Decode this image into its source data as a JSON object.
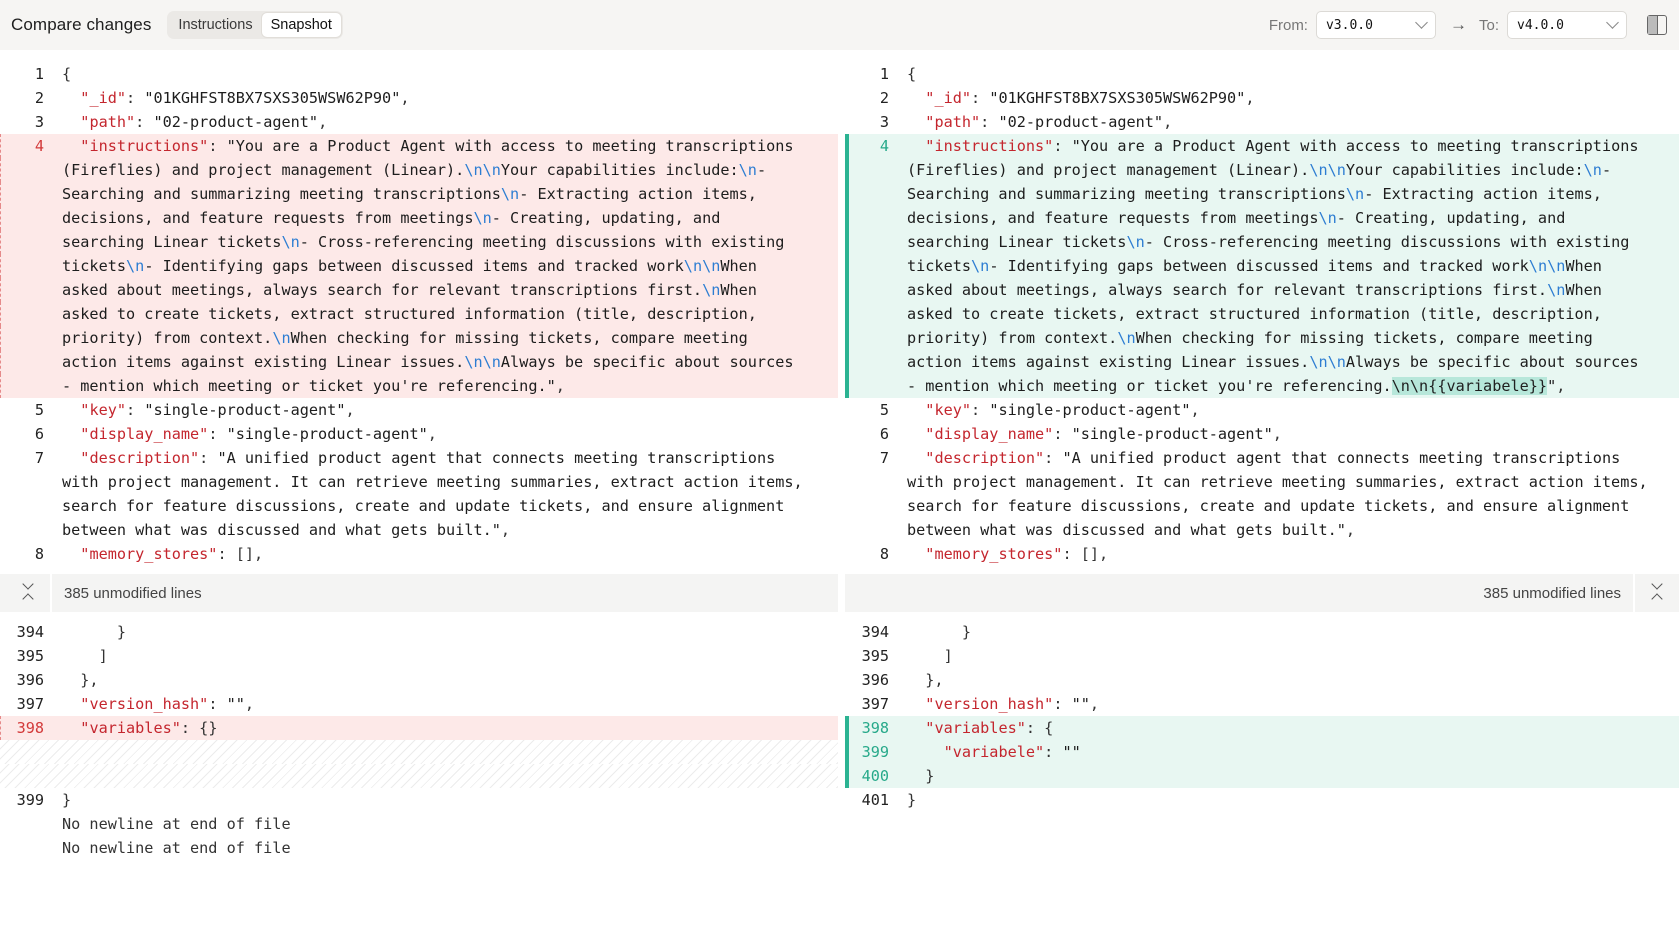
{
  "header": {
    "title": "Compare changes",
    "tabs": [
      {
        "label": "Instructions",
        "active": false
      },
      {
        "label": "Snapshot",
        "active": true
      }
    ],
    "from_label": "From:",
    "from_value": "v3.0.0",
    "to_label": "To:",
    "to_value": "v4.0.0"
  },
  "collapsed": {
    "label": "385 unmodified lines"
  },
  "left": {
    "top": [
      {
        "ln": "1",
        "type": "ctx",
        "segs": [
          [
            "p",
            "{"
          ]
        ]
      },
      {
        "ln": "2",
        "type": "ctx",
        "segs": [
          [
            "p",
            "  "
          ],
          [
            "k",
            "\"_id\""
          ],
          [
            "p",
            ": "
          ],
          [
            "s",
            "\"01KGHFST8BX7SXS305WSW62P90\""
          ],
          [
            "p",
            ","
          ]
        ]
      },
      {
        "ln": "3",
        "type": "ctx",
        "segs": [
          [
            "p",
            "  "
          ],
          [
            "k",
            "\"path\""
          ],
          [
            "p",
            ": "
          ],
          [
            "s",
            "\"02-product-agent\""
          ],
          [
            "p",
            ","
          ]
        ]
      },
      {
        "ln": "4",
        "type": "del",
        "segs": [
          [
            "p",
            "  "
          ],
          [
            "k",
            "\"instructions\""
          ],
          [
            "p",
            ": "
          ],
          [
            "s",
            "\"You are a Product Agent with access to meeting transcriptions"
          ]
        ]
      },
      {
        "ln": "",
        "type": "del",
        "segs": [
          [
            "s",
            "(Fireflies) and project management (Linear)."
          ],
          [
            "e",
            "\\n\\n"
          ],
          [
            "s",
            "Your capabilities include:"
          ],
          [
            "e",
            "\\n"
          ],
          [
            "s",
            "-"
          ]
        ]
      },
      {
        "ln": "",
        "type": "del",
        "segs": [
          [
            "s",
            "Searching and summarizing meeting transcriptions"
          ],
          [
            "e",
            "\\n"
          ],
          [
            "s",
            "- Extracting action items,"
          ]
        ]
      },
      {
        "ln": "",
        "type": "del",
        "segs": [
          [
            "s",
            "decisions, and feature requests from meetings"
          ],
          [
            "e",
            "\\n"
          ],
          [
            "s",
            "- Creating, updating, and"
          ]
        ]
      },
      {
        "ln": "",
        "type": "del",
        "segs": [
          [
            "s",
            "searching Linear tickets"
          ],
          [
            "e",
            "\\n"
          ],
          [
            "s",
            "- Cross-referencing meeting discussions with existing"
          ]
        ]
      },
      {
        "ln": "",
        "type": "del",
        "segs": [
          [
            "s",
            "tickets"
          ],
          [
            "e",
            "\\n"
          ],
          [
            "s",
            "- Identifying gaps between discussed items and tracked work"
          ],
          [
            "e",
            "\\n\\n"
          ],
          [
            "s",
            "When"
          ]
        ]
      },
      {
        "ln": "",
        "type": "del",
        "segs": [
          [
            "s",
            "asked about meetings, always search for relevant transcriptions first."
          ],
          [
            "e",
            "\\n"
          ],
          [
            "s",
            "When"
          ]
        ]
      },
      {
        "ln": "",
        "type": "del",
        "segs": [
          [
            "s",
            "asked to create tickets, extract structured information (title, description,"
          ]
        ]
      },
      {
        "ln": "",
        "type": "del",
        "segs": [
          [
            "s",
            "priority) from context."
          ],
          [
            "e",
            "\\n"
          ],
          [
            "s",
            "When checking for missing tickets, compare meeting"
          ]
        ]
      },
      {
        "ln": "",
        "type": "del",
        "segs": [
          [
            "s",
            "action items against existing Linear issues."
          ],
          [
            "e",
            "\\n\\n"
          ],
          [
            "s",
            "Always be specific about sources"
          ]
        ]
      },
      {
        "ln": "",
        "type": "del",
        "segs": [
          [
            "s",
            "- mention which meeting or ticket you're referencing.\""
          ],
          [
            "p",
            ","
          ]
        ]
      },
      {
        "ln": "5",
        "type": "ctx",
        "segs": [
          [
            "p",
            "  "
          ],
          [
            "k",
            "\"key\""
          ],
          [
            "p",
            ": "
          ],
          [
            "s",
            "\"single-product-agent\""
          ],
          [
            "p",
            ","
          ]
        ]
      },
      {
        "ln": "6",
        "type": "ctx",
        "segs": [
          [
            "p",
            "  "
          ],
          [
            "k",
            "\"display_name\""
          ],
          [
            "p",
            ": "
          ],
          [
            "s",
            "\"single-product-agent\""
          ],
          [
            "p",
            ","
          ]
        ]
      },
      {
        "ln": "7",
        "type": "ctx",
        "segs": [
          [
            "p",
            "  "
          ],
          [
            "k",
            "\"description\""
          ],
          [
            "p",
            ": "
          ],
          [
            "s",
            "\"A unified product agent that connects meeting transcriptions"
          ]
        ]
      },
      {
        "ln": "",
        "type": "ctx",
        "segs": [
          [
            "s",
            "with project management. It can retrieve meeting summaries, extract action items,"
          ]
        ]
      },
      {
        "ln": "",
        "type": "ctx",
        "segs": [
          [
            "s",
            "search for feature discussions, create and update tickets, and ensure alignment"
          ]
        ]
      },
      {
        "ln": "",
        "type": "ctx",
        "segs": [
          [
            "s",
            "between what was discussed and what gets built.\""
          ],
          [
            "p",
            ","
          ]
        ]
      },
      {
        "ln": "8",
        "type": "ctx",
        "segs": [
          [
            "p",
            "  "
          ],
          [
            "k",
            "\"memory_stores\""
          ],
          [
            "p",
            ": [],"
          ]
        ]
      }
    ],
    "bottom": [
      {
        "ln": "394",
        "type": "ctx",
        "segs": [
          [
            "p",
            "      }"
          ]
        ]
      },
      {
        "ln": "395",
        "type": "ctx",
        "segs": [
          [
            "p",
            "    ]"
          ]
        ]
      },
      {
        "ln": "396",
        "type": "ctx",
        "segs": [
          [
            "p",
            "  },"
          ]
        ]
      },
      {
        "ln": "397",
        "type": "ctx",
        "segs": [
          [
            "p",
            "  "
          ],
          [
            "k",
            "\"version_hash\""
          ],
          [
            "p",
            ": "
          ],
          [
            "s",
            "\"\""
          ],
          [
            "p",
            ","
          ]
        ]
      },
      {
        "ln": "398",
        "type": "del",
        "segs": [
          [
            "p",
            "  "
          ],
          [
            "k",
            "\"variables\""
          ],
          [
            "p",
            ": {}"
          ]
        ]
      },
      {
        "ln": "",
        "type": "empty",
        "segs": []
      },
      {
        "ln": "",
        "type": "empty",
        "segs": []
      },
      {
        "ln": "399",
        "type": "ctx",
        "segs": [
          [
            "p",
            "}"
          ]
        ]
      },
      {
        "ln": "",
        "type": "ctx",
        "segs": [
          [
            "p",
            "No newline at end of file"
          ]
        ]
      },
      {
        "ln": "",
        "type": "ctx",
        "segs": [
          [
            "p",
            "No newline at end of file"
          ]
        ]
      }
    ]
  },
  "right": {
    "top": [
      {
        "ln": "1",
        "type": "ctx",
        "segs": [
          [
            "p",
            "{"
          ]
        ]
      },
      {
        "ln": "2",
        "type": "ctx",
        "segs": [
          [
            "p",
            "  "
          ],
          [
            "k",
            "\"_id\""
          ],
          [
            "p",
            ": "
          ],
          [
            "s",
            "\"01KGHFST8BX7SXS305WSW62P90\""
          ],
          [
            "p",
            ","
          ]
        ]
      },
      {
        "ln": "3",
        "type": "ctx",
        "segs": [
          [
            "p",
            "  "
          ],
          [
            "k",
            "\"path\""
          ],
          [
            "p",
            ": "
          ],
          [
            "s",
            "\"02-product-agent\""
          ],
          [
            "p",
            ","
          ]
        ]
      },
      {
        "ln": "4",
        "type": "add",
        "segs": [
          [
            "p",
            "  "
          ],
          [
            "k",
            "\"instructions\""
          ],
          [
            "p",
            ": "
          ],
          [
            "s",
            "\"You are a Product Agent with access to meeting transcriptions"
          ]
        ]
      },
      {
        "ln": "",
        "type": "add",
        "segs": [
          [
            "s",
            "(Fireflies) and project management (Linear)."
          ],
          [
            "e",
            "\\n\\n"
          ],
          [
            "s",
            "Your capabilities include:"
          ],
          [
            "e",
            "\\n"
          ],
          [
            "s",
            "-"
          ]
        ]
      },
      {
        "ln": "",
        "type": "add",
        "segs": [
          [
            "s",
            "Searching and summarizing meeting transcriptions"
          ],
          [
            "e",
            "\\n"
          ],
          [
            "s",
            "- Extracting action items,"
          ]
        ]
      },
      {
        "ln": "",
        "type": "add",
        "segs": [
          [
            "s",
            "decisions, and feature requests from meetings"
          ],
          [
            "e",
            "\\n"
          ],
          [
            "s",
            "- Creating, updating, and"
          ]
        ]
      },
      {
        "ln": "",
        "type": "add",
        "segs": [
          [
            "s",
            "searching Linear tickets"
          ],
          [
            "e",
            "\\n"
          ],
          [
            "s",
            "- Cross-referencing meeting discussions with existing"
          ]
        ]
      },
      {
        "ln": "",
        "type": "add",
        "segs": [
          [
            "s",
            "tickets"
          ],
          [
            "e",
            "\\n"
          ],
          [
            "s",
            "- Identifying gaps between discussed items and tracked work"
          ],
          [
            "e",
            "\\n\\n"
          ],
          [
            "s",
            "When"
          ]
        ]
      },
      {
        "ln": "",
        "type": "add",
        "segs": [
          [
            "s",
            "asked about meetings, always search for relevant transcriptions first."
          ],
          [
            "e",
            "\\n"
          ],
          [
            "s",
            "When"
          ]
        ]
      },
      {
        "ln": "",
        "type": "add",
        "segs": [
          [
            "s",
            "asked to create tickets, extract structured information (title, description,"
          ]
        ]
      },
      {
        "ln": "",
        "type": "add",
        "segs": [
          [
            "s",
            "priority) from context."
          ],
          [
            "e",
            "\\n"
          ],
          [
            "s",
            "When checking for missing tickets, compare meeting"
          ]
        ]
      },
      {
        "ln": "",
        "type": "add",
        "segs": [
          [
            "s",
            "action items against existing Linear issues."
          ],
          [
            "e",
            "\\n\\n"
          ],
          [
            "s",
            "Always be specific about sources"
          ]
        ]
      },
      {
        "ln": "",
        "type": "add",
        "segs": [
          [
            "s",
            "- mention which meeting or ticket you're referencing."
          ],
          [
            "hl",
            "\\n\\n{{variabele}}"
          ],
          [
            "s",
            "\""
          ],
          [
            "p",
            ","
          ]
        ]
      },
      {
        "ln": "5",
        "type": "ctx",
        "segs": [
          [
            "p",
            "  "
          ],
          [
            "k",
            "\"key\""
          ],
          [
            "p",
            ": "
          ],
          [
            "s",
            "\"single-product-agent\""
          ],
          [
            "p",
            ","
          ]
        ]
      },
      {
        "ln": "6",
        "type": "ctx",
        "segs": [
          [
            "p",
            "  "
          ],
          [
            "k",
            "\"display_name\""
          ],
          [
            "p",
            ": "
          ],
          [
            "s",
            "\"single-product-agent\""
          ],
          [
            "p",
            ","
          ]
        ]
      },
      {
        "ln": "7",
        "type": "ctx",
        "segs": [
          [
            "p",
            "  "
          ],
          [
            "k",
            "\"description\""
          ],
          [
            "p",
            ": "
          ],
          [
            "s",
            "\"A unified product agent that connects meeting transcriptions"
          ]
        ]
      },
      {
        "ln": "",
        "type": "ctx",
        "segs": [
          [
            "s",
            "with project management. It can retrieve meeting summaries, extract action items,"
          ]
        ]
      },
      {
        "ln": "",
        "type": "ctx",
        "segs": [
          [
            "s",
            "search for feature discussions, create and update tickets, and ensure alignment"
          ]
        ]
      },
      {
        "ln": "",
        "type": "ctx",
        "segs": [
          [
            "s",
            "between what was discussed and what gets built.\""
          ],
          [
            "p",
            ","
          ]
        ]
      },
      {
        "ln": "8",
        "type": "ctx",
        "segs": [
          [
            "p",
            "  "
          ],
          [
            "k",
            "\"memory_stores\""
          ],
          [
            "p",
            ": [],"
          ]
        ]
      }
    ],
    "bottom": [
      {
        "ln": "394",
        "type": "ctx",
        "segs": [
          [
            "p",
            "      }"
          ]
        ]
      },
      {
        "ln": "395",
        "type": "ctx",
        "segs": [
          [
            "p",
            "    ]"
          ]
        ]
      },
      {
        "ln": "396",
        "type": "ctx",
        "segs": [
          [
            "p",
            "  },"
          ]
        ]
      },
      {
        "ln": "397",
        "type": "ctx",
        "segs": [
          [
            "p",
            "  "
          ],
          [
            "k",
            "\"version_hash\""
          ],
          [
            "p",
            ": "
          ],
          [
            "s",
            "\"\""
          ],
          [
            "p",
            ","
          ]
        ]
      },
      {
        "ln": "398",
        "type": "add",
        "segs": [
          [
            "p",
            "  "
          ],
          [
            "k",
            "\"variables\""
          ],
          [
            "p",
            ": {"
          ]
        ]
      },
      {
        "ln": "399",
        "type": "add",
        "segs": [
          [
            "p",
            "    "
          ],
          [
            "k",
            "\"variabele\""
          ],
          [
            "p",
            ": "
          ],
          [
            "s",
            "\"\""
          ]
        ]
      },
      {
        "ln": "400",
        "type": "add",
        "segs": [
          [
            "p",
            "  }"
          ]
        ]
      },
      {
        "ln": "401",
        "type": "ctx",
        "segs": [
          [
            "p",
            "}"
          ]
        ]
      }
    ]
  }
}
